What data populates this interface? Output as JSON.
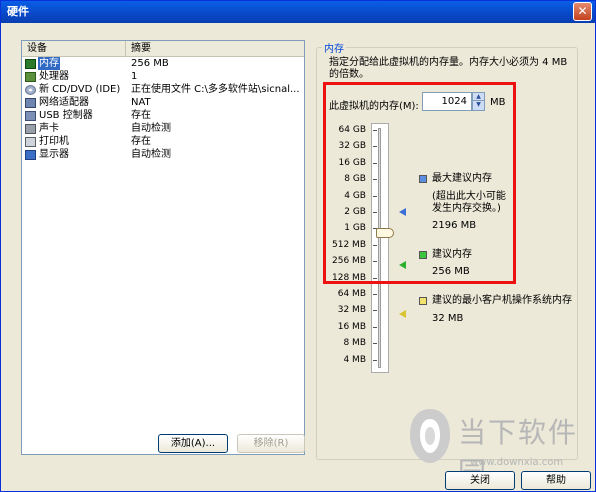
{
  "window": {
    "title": "硬件",
    "close_glyph": "✕"
  },
  "device_list": {
    "columns": [
      "设备",
      "摘要"
    ],
    "rows": [
      {
        "icon": "memory-icon",
        "name": "内存",
        "summary": "256 MB",
        "selected": true
      },
      {
        "icon": "processor-icon",
        "name": "处理器",
        "summary": "1"
      },
      {
        "icon": "cd-dvd-icon",
        "name": "新 CD/DVD (IDE)",
        "summary": "正在使用文件 C:\\多多软件站\\sicnal..."
      },
      {
        "icon": "network-adapter-icon",
        "name": "网络适配器",
        "summary": "NAT"
      },
      {
        "icon": "usb-controller-icon",
        "name": "USB 控制器",
        "summary": "存在"
      },
      {
        "icon": "sound-card-icon",
        "name": "声卡",
        "summary": "自动检测"
      },
      {
        "icon": "printer-icon",
        "name": "打印机",
        "summary": "存在"
      },
      {
        "icon": "display-icon",
        "name": "显示器",
        "summary": "自动检测"
      }
    ]
  },
  "buttons": {
    "add": "添加(A)...",
    "remove": "移除(R)",
    "close": "关闭",
    "help": "帮助"
  },
  "memory": {
    "group_title": "内存",
    "description": "指定分配给此虚拟机的内存量。内存大小必须为 4 MB 的倍数。",
    "field_label": "此虚拟机的内存(M):",
    "value": "1024",
    "unit": "MB",
    "scale_labels": [
      "64 GB",
      "32 GB",
      "16 GB",
      "8 GB",
      "4 GB",
      "2 GB",
      "1 GB",
      "512 MB",
      "256 MB",
      "128 MB",
      "64 MB",
      "32 MB",
      "16 MB",
      "8 MB",
      "4 MB"
    ],
    "legend": {
      "max_recommended_title": "最大建议内存",
      "max_recommended_note": "(超出此大小可能发生内存交换。)",
      "max_recommended_value": "2196 MB",
      "recommended_title": "建议内存",
      "recommended_value": "256 MB",
      "min_guest_title": "建议的最小客户机操作系统内存",
      "min_guest_value": "32 MB"
    }
  },
  "watermark": {
    "text": "当下软件园",
    "url": "www.downxia.com"
  },
  "colors": {
    "highlight": "#ee1111",
    "selection": "#316ac5",
    "group_title": "#0046d5"
  }
}
